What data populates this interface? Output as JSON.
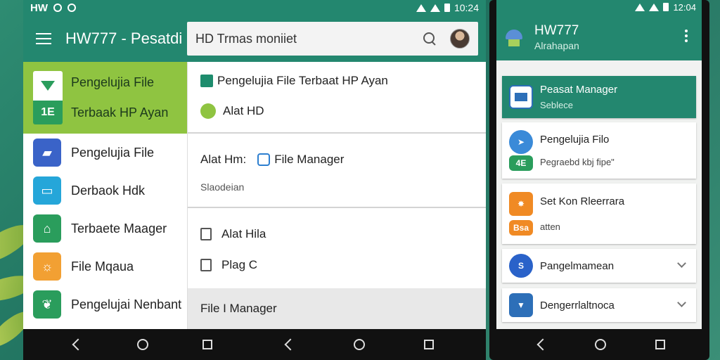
{
  "tablet": {
    "status": {
      "carrier": "HW",
      "time": "10:24"
    },
    "appbar": {
      "title": "HW777 - Pesatdi"
    },
    "search": {
      "text": "HD Trmas moniiet"
    },
    "drawer": {
      "header": {
        "line1": "Pengelujia File",
        "line2": "Terbaak HP Ayan",
        "icon_text": "1E"
      },
      "items": [
        {
          "label": "Pengelujia File",
          "icon": "window-icon",
          "color": "#3a63c8"
        },
        {
          "label": "Derbaok Hdk",
          "icon": "card-icon",
          "color": "#25a6d9"
        },
        {
          "label": "Terbaete Maager",
          "icon": "home-icon",
          "color": "#2a9d5c"
        },
        {
          "label": "File Mqaua",
          "icon": "sun-icon",
          "color": "#f2a033"
        },
        {
          "label": "Pengelujai Nenbant",
          "icon": "leaf-icon",
          "color": "#2a9d5c"
        }
      ]
    },
    "content": {
      "row1": "Pengelujia File Terbaat HP Ayan",
      "row2": "Alat HD",
      "row3_label": "Alat Hm:",
      "row3_value": "File Manager",
      "row3_sub": "Slaodeian",
      "row4": "Alat Hila",
      "row5": "Plag C",
      "footer": "File I Manager"
    }
  },
  "phone": {
    "status": {
      "time": "12:04"
    },
    "appbar": {
      "title": "HW777",
      "subtitle": "Alrahapan"
    },
    "cards": [
      {
        "title": "Peasat Manager",
        "sub": "Seblece",
        "icon": "laptop-icon",
        "color": "#2d6fb8",
        "active": true
      },
      {
        "title": "Pengelujia Filo",
        "sub": "Pegraebd kbj fipe\"",
        "icon": "compass-icon",
        "color": "#3a8ad8",
        "icon_text": "4E",
        "active": false
      },
      {
        "title": "Set Kon Rleerrara",
        "sub": "atten",
        "icon": "flame-icon",
        "color": "#f08a24",
        "icon_text": "Bsa",
        "active": false
      },
      {
        "title": "Pangelmamean",
        "sub": "",
        "icon": "s-logo-icon",
        "color": "#2a62c9",
        "active": false
      },
      {
        "title": "Dengerrlaltnoca",
        "sub": "",
        "icon": "download-icon",
        "color": "#2d6fb8",
        "active": false
      }
    ]
  }
}
